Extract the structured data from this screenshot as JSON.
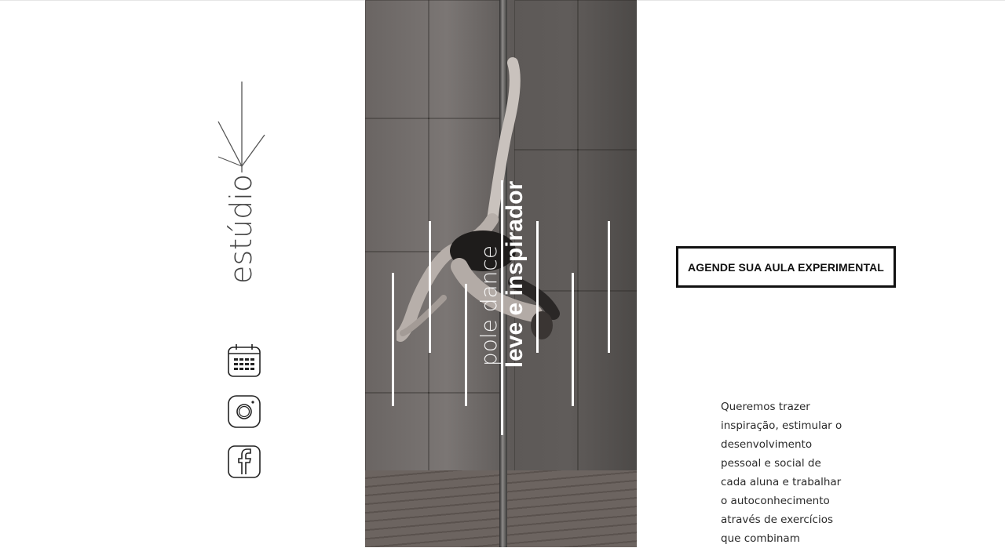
{
  "brand": {
    "logo_text": "estúdio",
    "logo_mark": "V"
  },
  "social": [
    {
      "icon": "calendar-icon",
      "label": "calendar"
    },
    {
      "icon": "instagram-icon",
      "label": "instagram"
    },
    {
      "icon": "facebook-icon",
      "label": "facebook"
    }
  ],
  "hero": {
    "tagline_light": "pole dance",
    "tagline_bold": "leve e inspirador"
  },
  "cta": {
    "label": "AGENDE SUA AULA EXPERIMENTAL"
  },
  "intro": {
    "lines": [
      "Queremos trazer",
      "inspiração, estimular o",
      "desenvolvimento",
      "pessoal e social de",
      "cada aluna e trabalhar",
      "o autoconhecimento",
      "através de exercícios",
      "que combinam"
    ]
  },
  "colors": {
    "text": "#111111",
    "background": "#ffffff",
    "overlay_lines": "#ffffff"
  }
}
